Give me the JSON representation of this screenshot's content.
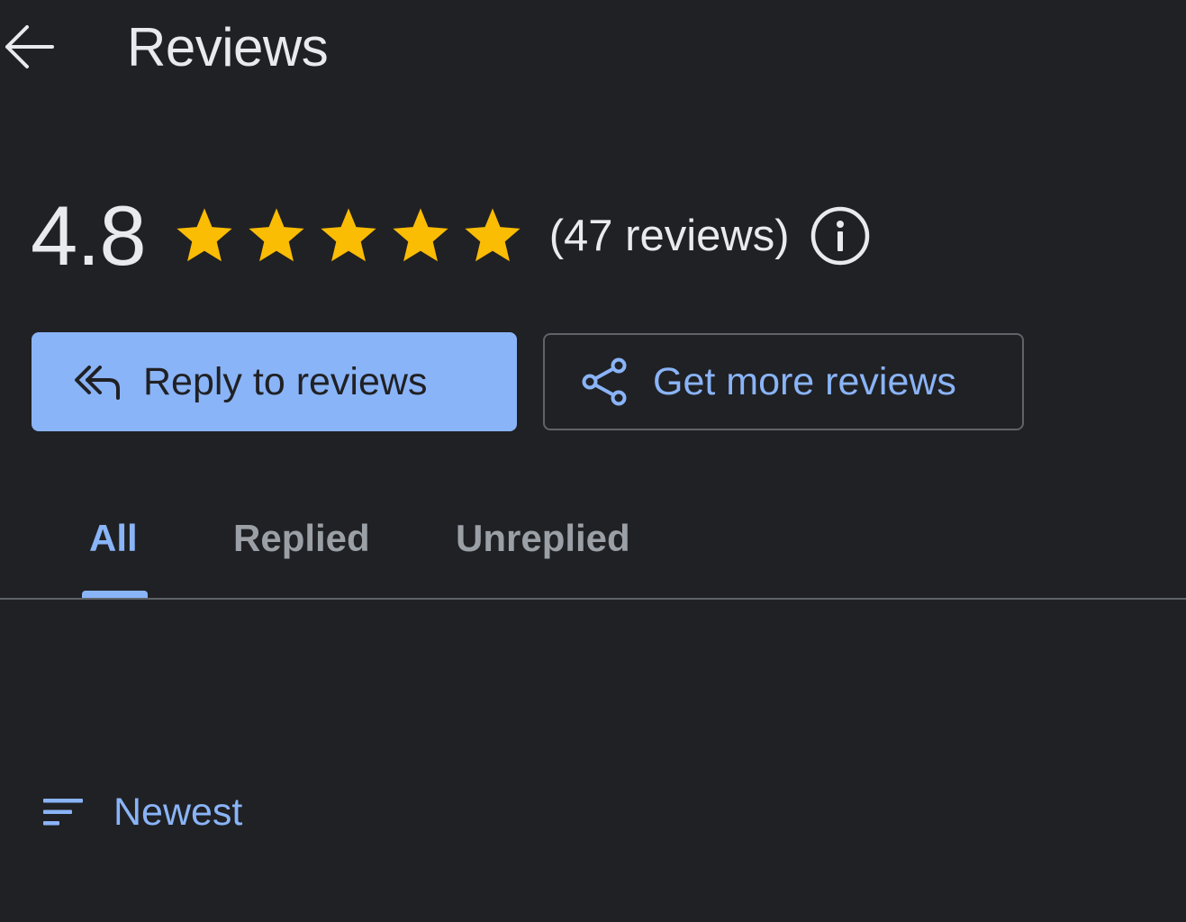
{
  "header": {
    "title": "Reviews",
    "back_icon": "arrow-back-icon"
  },
  "summary": {
    "rating": "4.8",
    "stars_filled": 5,
    "stars_total": 5,
    "star_color": "#fbbc04",
    "review_count": "(47 reviews)",
    "info_icon": "info-icon"
  },
  "actions": {
    "reply": {
      "label": "Reply to reviews",
      "icon": "reply-all-icon"
    },
    "get_more": {
      "label": "Get more reviews",
      "icon": "share-icon"
    }
  },
  "tabs": [
    {
      "label": "All",
      "active": true
    },
    {
      "label": "Replied",
      "active": false
    },
    {
      "label": "Unreplied",
      "active": false
    }
  ],
  "sort": {
    "label": "Newest",
    "icon": "sort-icon"
  },
  "colors": {
    "background": "#202124",
    "accent": "#8ab4f8",
    "text": "#e8eaed",
    "muted": "#9aa0a6",
    "divider": "#5f6368"
  }
}
